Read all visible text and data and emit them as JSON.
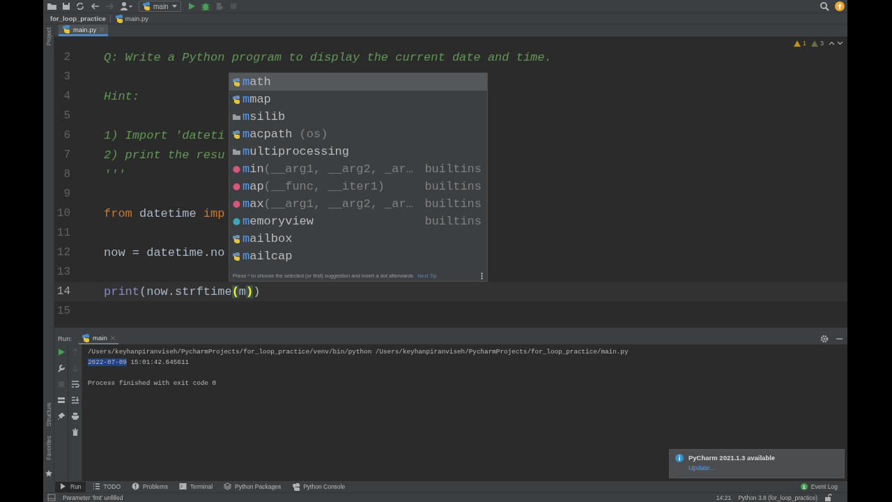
{
  "toolbar": {
    "run_config": "main"
  },
  "breadcrumbs": [
    "for_loop_practice",
    "main.py"
  ],
  "editor_tabs": [
    {
      "label": "main.py",
      "selected": true
    }
  ],
  "side_panels": {
    "top": [
      "Project"
    ],
    "bottom": [
      "Structure",
      "Favorites"
    ]
  },
  "editor": {
    "inspections": [
      {
        "kind": "warning",
        "count": "1"
      },
      {
        "kind": "weak",
        "count": "3"
      }
    ],
    "lines": [
      {
        "number": "2",
        "current": false,
        "tokens": [
          {
            "kind": "doc",
            "text": "Q: Write a Python program to display the current date and time."
          }
        ]
      },
      {
        "number": "3",
        "current": false
      },
      {
        "number": "4",
        "current": false,
        "tokens": [
          {
            "kind": "doc",
            "text": "Hint:"
          }
        ]
      },
      {
        "number": "5",
        "current": false
      },
      {
        "number": "6",
        "current": false,
        "tokens": [
          {
            "kind": "doc",
            "text": "1) Import 'dateti"
          }
        ]
      },
      {
        "number": "7",
        "current": false,
        "tokens": [
          {
            "kind": "doc",
            "text": "2) print the resu"
          }
        ]
      },
      {
        "number": "8",
        "current": false,
        "tokens": [
          {
            "kind": "doc",
            "text": "'''"
          }
        ]
      },
      {
        "number": "9",
        "current": false
      },
      {
        "number": "10",
        "current": false,
        "tokens": [
          {
            "kind": "kw",
            "text": "from"
          },
          {
            "kind": "plain",
            "text": " datetime "
          },
          {
            "kind": "kw",
            "text": "imp"
          }
        ]
      },
      {
        "number": "11",
        "current": false
      },
      {
        "number": "12",
        "current": false,
        "tokens": [
          {
            "kind": "plain",
            "text": "now = datetime.no"
          }
        ]
      },
      {
        "number": "13",
        "current": false
      },
      {
        "number": "14",
        "current": true,
        "tokens": [
          {
            "kind": "builtin",
            "text": "print"
          },
          {
            "kind": "plain",
            "text": "(now.strftime"
          },
          {
            "kind": "brace",
            "text": "("
          },
          {
            "kind": "plain",
            "text": "m"
          },
          {
            "kind": "brace",
            "text": ")"
          },
          {
            "kind": "plain",
            "text": ")"
          }
        ]
      },
      {
        "number": "15",
        "current": false
      }
    ]
  },
  "completion": {
    "items": [
      {
        "kind": "module",
        "match": "m",
        "rest": "ath",
        "selected": true
      },
      {
        "kind": "module",
        "match": "m",
        "rest": "map",
        "selected": false
      },
      {
        "kind": "package",
        "match": "m",
        "rest": "silib",
        "selected": false
      },
      {
        "kind": "module",
        "match": "m",
        "rest": "acpath",
        "params": " (os)",
        "selected": false
      },
      {
        "kind": "package",
        "match": "m",
        "rest": "ultiprocessing",
        "selected": false
      },
      {
        "kind": "function",
        "match": "m",
        "rest": "in",
        "params": "(__arg1, __arg2, _ar…",
        "detail": "builtins",
        "selected": false
      },
      {
        "kind": "function",
        "match": "m",
        "rest": "ap",
        "params": "(__func, __iter1)",
        "detail": "builtins",
        "selected": false
      },
      {
        "kind": "function",
        "match": "m",
        "rest": "ax",
        "params": "(__arg1, __arg2, _ar…",
        "detail": "builtins",
        "selected": false
      },
      {
        "kind": "class",
        "match": "m",
        "rest": "emoryview",
        "detail": "builtins",
        "selected": false
      },
      {
        "kind": "module",
        "match": "m",
        "rest": "ailbox",
        "selected": false
      },
      {
        "kind": "module",
        "match": "m",
        "rest": "ailcap",
        "selected": false
      }
    ],
    "hint": "Press ^ to choose the selected (or first) suggestion and insert a dot afterwards",
    "tip_link": "Next Tip"
  },
  "run": {
    "title": "Run:",
    "tabs": [
      {
        "label": "main",
        "selected": true
      }
    ],
    "output": [
      {
        "kind": "text",
        "text": "/Users/keyhanpiranviseh/PycharmProjects/for_loop_practice/venv/bin/python /Users/keyhanpiranviseh/PycharmProjects/for_loop_practice/main.py"
      },
      {
        "kind": "text",
        "highlight": "2022-07-09",
        "text": " 15:01:42.645611"
      },
      {
        "kind": "blank"
      },
      {
        "kind": "text",
        "text": "Process finished with exit code 0"
      }
    ]
  },
  "notification": {
    "title": "PyCharm 2021.1.3 available",
    "action": "Update..."
  },
  "tool_tabs": [
    {
      "label": "Run",
      "selected": true
    },
    {
      "label": "TODO",
      "selected": false
    },
    {
      "label": "Problems",
      "selected": false
    },
    {
      "label": "Terminal",
      "selected": false
    },
    {
      "label": "Python Packages",
      "selected": false
    },
    {
      "label": "Python Console",
      "selected": false
    }
  ],
  "event_log": {
    "label": "Event Log",
    "count": "1"
  },
  "status_bar": {
    "message": "Parameter 'fmt' unfilled",
    "position": "14:21",
    "interpreter": "Python 3.8 (for_loop_practice)"
  }
}
